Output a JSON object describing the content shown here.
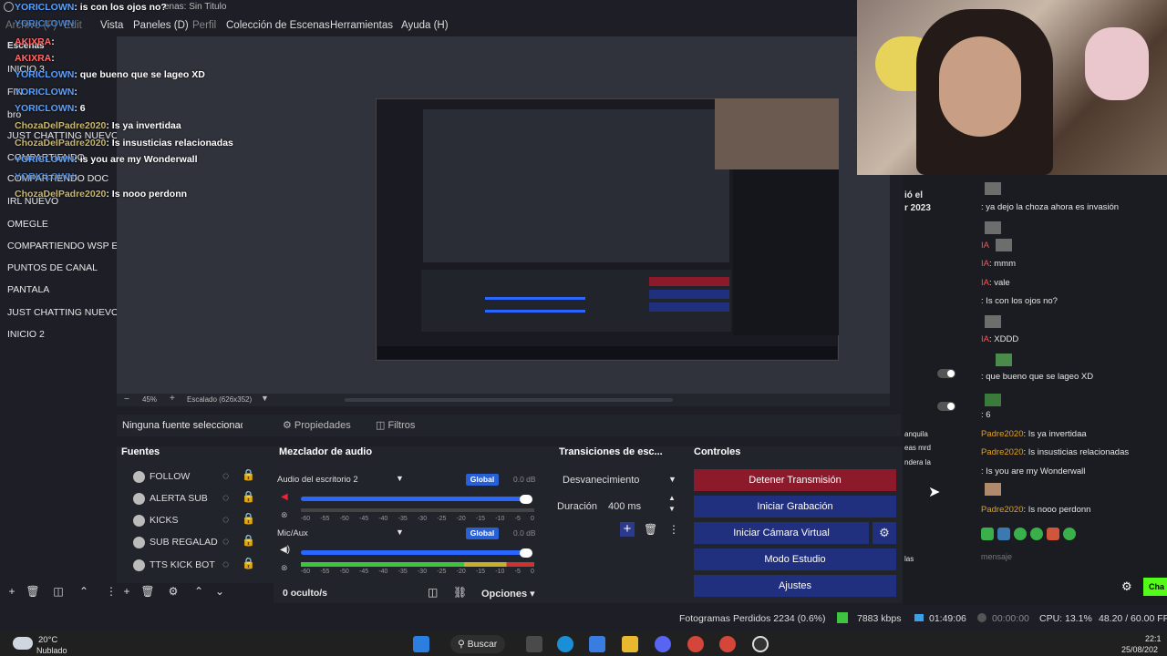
{
  "title": "enas: Sin Titulo",
  "menu": [
    "Archivo (F)",
    "Edit",
    "Vista",
    "Paneles (D)",
    "Perfil",
    "Colección de Escenas",
    "Herramientas",
    "Ayuda (H)"
  ],
  "scenes_header": "Escenas",
  "scenes": [
    "INICIO 3",
    "FIN",
    "bro",
    "JUST CHATTING NUEVO",
    "COMPARTIENDO",
    "COMPARTIENDO DOC",
    "IRL NUEVO",
    "OMEGLE",
    "COMPARTIENDO WSP E",
    "PUNTOS DE CANAL",
    "PANTALA",
    "JUST CHATTING NUEVO",
    "INICIO 2"
  ],
  "chat_overlay": [
    {
      "name": "YORICLOWN",
      "msg": ": is con los ojos no?",
      "color": "blue"
    },
    {
      "name": "YORICLOWN",
      "msg": "",
      "color": "blue"
    },
    {
      "name": "AKIXRA",
      "msg": ":",
      "color": "red"
    },
    {
      "name": "AKIXRA",
      "msg": ":",
      "color": "red"
    },
    {
      "name": "YORICLOWN",
      "msg": ": que bueno que se lageo XD",
      "color": "blue"
    },
    {
      "name": "YORICLOWN",
      "msg": ":",
      "color": "blue"
    },
    {
      "name": "YORICLOWN",
      "msg": ": 6",
      "color": "blue"
    },
    {
      "name": "ChozaDelPadre2020",
      "msg": ": Is ya invertidaa",
      "color": "gold"
    },
    {
      "name": "ChozaDelPadre2020",
      "msg": ": Is insusticias relacionadas",
      "color": "gold"
    },
    {
      "name": "YORICLOWN",
      "msg": ": is you are my Wonderwall",
      "color": "blue"
    },
    {
      "name": "YORICLOWN",
      "msg": ":",
      "color": "blue"
    },
    {
      "name": "ChozaDelPadre2020",
      "msg": ": Is nooo perdonn",
      "color": "gold"
    }
  ],
  "zoom": {
    "percent": "45%",
    "scale": "Escalado (626x352)"
  },
  "source_bar": {
    "selected": "Ninguna fuente seleccionada",
    "properties": "Propiedades",
    "filters": "Filtros"
  },
  "docks": {
    "sources": "Fuentes",
    "mixer": "Mezclador de audio",
    "transitions": "Transiciones de esc...",
    "controls": "Controles"
  },
  "sources": [
    "FOLLOW",
    "ALERTA SUB",
    "KICKS",
    "SUB REGALAD",
    "TTS KICK BOT"
  ],
  "mixer": [
    {
      "label": "Audio del escritorio 2",
      "global": "Global",
      "db": "0.0 dB",
      "ticks": [
        "-60",
        "-55",
        "-50",
        "-45",
        "-40",
        "-35",
        "-30",
        "-25",
        "-20",
        "-15",
        "-10",
        "-5",
        "0"
      ]
    },
    {
      "label": "Mic/Aux",
      "global": "Global",
      "db": "0.0 dB"
    }
  ],
  "mixer_footer": {
    "hidden": "0 oculto/s",
    "options": "Opciones"
  },
  "transitions": {
    "type": "Desvanecimiento",
    "duration_label": "Duración",
    "duration_value": "400 ms"
  },
  "controls": [
    {
      "label": "Detener Transmisión",
      "color": "#8c1a2b"
    },
    {
      "label": "Iniciar Grabación",
      "color": "#21307e"
    },
    {
      "label": "Iniciar Cámara Virtual",
      "color": "#21307e"
    },
    {
      "label": "Modo Estudio",
      "color": "#21307e"
    },
    {
      "label": "Ajustes",
      "color": "#21307e"
    }
  ],
  "status": {
    "dropped": "Fotogramas Perdidos 2234 (0.6%)",
    "kbps": "7883 kbps",
    "live_time": "01:49:06",
    "rec_time": "00:00:00",
    "cpu": "CPU: 13.1%",
    "fps": "48.20 / 60.00 FP"
  },
  "taskbar": {
    "weather_temp": "20°C",
    "weather_desc": "Nublado",
    "search": "Buscar",
    "time": "22:1",
    "date": "25/08/202"
  },
  "right_chat": [
    {
      "name": "",
      "msg": ": ya dejo la choza ahora es invasión"
    },
    {
      "name": "IA",
      "msg": ""
    },
    {
      "name": "IA",
      "msg": ": mmm"
    },
    {
      "name": "IA",
      "msg": ": vale"
    },
    {
      "name": "",
      "msg": ": Is con los ojos no?"
    },
    {
      "name": "IA",
      "msg": ": XDDD"
    },
    {
      "name": "",
      "msg": ": que bueno que se lageo XD"
    },
    {
      "name": "",
      "msg": ": 6"
    },
    {
      "name": "Padre2020",
      "msg": ": Is ya invertidaa"
    },
    {
      "name": "Padre2020",
      "msg": ": Is insusticias relacionadas"
    },
    {
      "name": "",
      "msg": ": Is you are my Wonderwall"
    },
    {
      "name": "Padre2020",
      "msg": ": Is nooo perdonn"
    }
  ],
  "right_chat_input": "mensaje",
  "right_chat_send": "Cha",
  "mid_panel": {
    "line1": "ió el",
    "line2": "r 2023",
    "line3": "anquila",
    "line4": "eas mrd",
    "line5": "ndera la",
    "line6": "las"
  },
  "colors": {
    "accent_blue": "#2a66ff",
    "stop_red": "#8c1a2b",
    "button_blue": "#21307e"
  }
}
